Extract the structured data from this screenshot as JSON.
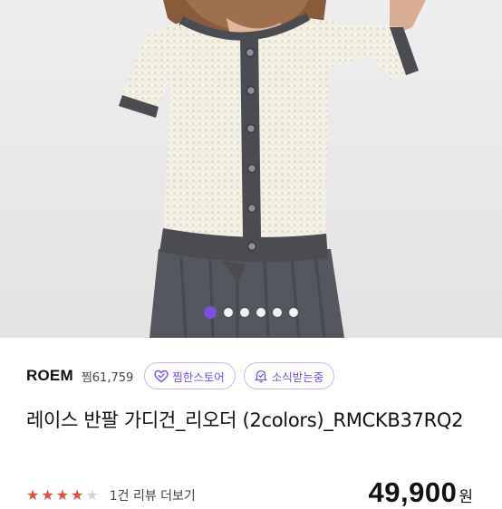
{
  "gallery": {
    "slide_count": 6,
    "active_index": 0
  },
  "store": {
    "name": "ROEM",
    "zzim": "찜61,759"
  },
  "buttons": {
    "zzim_store": {
      "label": "찜한스토어",
      "icon": "heart-check-icon"
    },
    "notify": {
      "label": "소식받는중",
      "icon": "bell-check-icon"
    }
  },
  "product": {
    "title": "레이스 반팔 가디건_리오더 (2colors)_RMCKB37RQ2",
    "rating": 4,
    "rating_max": 5,
    "review_count": "1건 리뷰 더보기",
    "price": "49,900",
    "price_unit": "원"
  },
  "colors": {
    "accent": "#7b4fe0",
    "star": "#e2503a"
  }
}
